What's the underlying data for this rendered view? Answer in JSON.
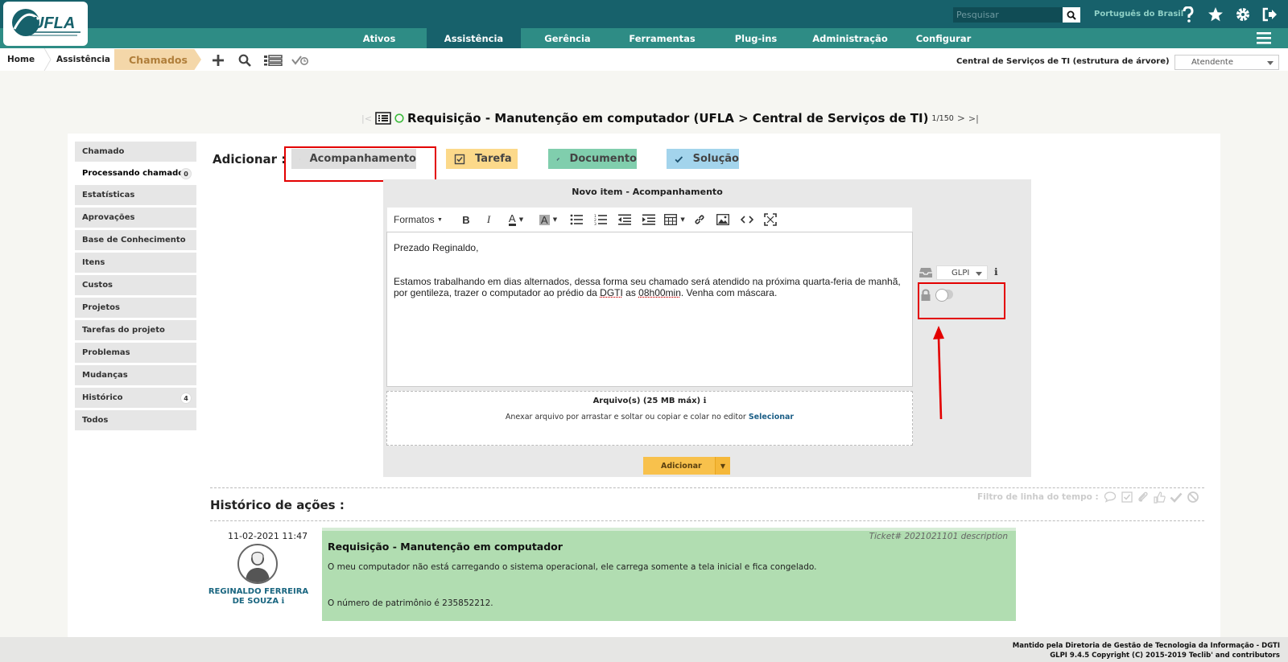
{
  "header": {
    "search_placeholder": "Pesquisar",
    "language": "Português do Brasil",
    "logo_text": "UFLA",
    "menu": [
      {
        "label": "Ativos"
      },
      {
        "label": "Assistência"
      },
      {
        "label": "Gerência"
      },
      {
        "label": "Ferramentas"
      },
      {
        "label": "Plug-ins"
      },
      {
        "label": "Administração"
      },
      {
        "label": "Configurar"
      }
    ],
    "active_menu": "Assistência",
    "colors": {
      "topbar": "#17616b",
      "menubar": "#2e8c85"
    }
  },
  "breadcrumb": {
    "items": [
      {
        "label": "Home"
      },
      {
        "label": "Assistência"
      }
    ],
    "current": "Chamados",
    "entity": "Central de Serviços de TI (estrutura de árvore)",
    "profile": "Atendente"
  },
  "title": {
    "text": "Requisição - Manutenção em computador (UFLA > Central de Serviços de TI)",
    "counter": "1/150"
  },
  "sidebar": {
    "items": [
      {
        "label": "Chamado"
      },
      {
        "label": "Processando chamado",
        "badge": "0"
      },
      {
        "label": "Estatísticas"
      },
      {
        "label": "Aprovações"
      },
      {
        "label": "Base de Conhecimento"
      },
      {
        "label": "Itens"
      },
      {
        "label": "Custos"
      },
      {
        "label": "Projetos"
      },
      {
        "label": "Tarefas do projeto"
      },
      {
        "label": "Problemas"
      },
      {
        "label": "Mudanças"
      },
      {
        "label": "Histórico",
        "badge": "4"
      },
      {
        "label": "Todos"
      }
    ],
    "current": "Processando chamado"
  },
  "add": {
    "label": "Adicionar :",
    "buttons": [
      {
        "label": "Acompanhamento",
        "color": "#dedede"
      },
      {
        "label": "Tarefa",
        "color": "#fcd98a"
      },
      {
        "label": "Documento",
        "color": "#80cead"
      },
      {
        "label": "Solução",
        "color": "#a3d4ec"
      }
    ]
  },
  "form": {
    "title": "Novo item - Acompanhamento",
    "formats_label": "Formatos",
    "editor": {
      "line1": "Prezado Reginaldo,",
      "line2a": "Estamos trabalhando em dias alternados, dessa forma seu chamado será atendido na próxima quarta-feria de manhã,",
      "line2b_pre": "por gentileza, trazer o computador ao prédio da ",
      "line2b_dgti": "DGTI",
      "line2b_mid": " as ",
      "line2b_time": "08h00min",
      "line2b_post": ". Venha com máscara."
    },
    "attachments_title": "Arquivo(s) (25 MB máx)",
    "attachments_help": "Anexar arquivo por arrastar e soltar ou copiar e colar no editor",
    "attachments_select": "Selecionar",
    "source": "GLPI",
    "submit": "Adicionar"
  },
  "history": {
    "title": "Histórico de ações :",
    "filter_label": "Filtro de linha do tempo :",
    "entry": {
      "date": "11-02-2021 11:47",
      "author_line1": "REGINALDO FERREIRA",
      "author_line2": "DE SOUZA",
      "meta": "Ticket# 2021021101 description",
      "title": "Requisição - Manutenção em computador",
      "p1": "O meu computador não está carregando o sistema operacional, ele carrega somente a tela inicial e fica congelado.",
      "p2": "O número de patrimônio é 235852212."
    }
  },
  "footer": {
    "line1": "Mantido pela Diretoria de Gestão de Tecnologia da Informação - DGTI",
    "line2": "GLPI 9.4.5 Copyright (C) 2015-2019 Teclib' and contributors"
  }
}
